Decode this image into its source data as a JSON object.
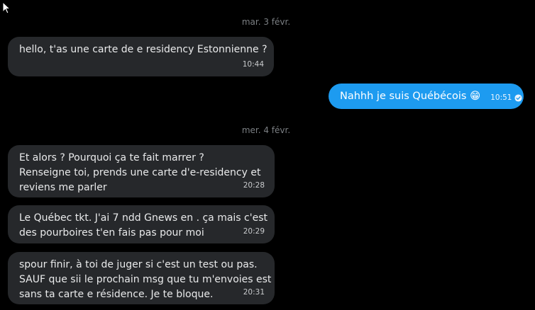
{
  "conversation": {
    "dates": [
      "mar. 3 févr.",
      "mer. 4 févr."
    ],
    "messages": [
      {
        "direction": "incoming",
        "lines": [
          "hello, t'as une carte de e residency Estonnienne ?"
        ],
        "time": "10:44"
      },
      {
        "direction": "outgoing",
        "text": "Nahhh je suis Québécois 😁",
        "time": "10:51",
        "status_icon": "read-check-icon"
      },
      {
        "direction": "incoming",
        "lines": [
          "Et alors ? Pourquoi ça te fait marrer ?",
          "Renseigne toi, prends une carte d'e-residency et",
          "reviens me parler"
        ],
        "time": "20:28"
      },
      {
        "direction": "incoming",
        "lines": [
          "Le Québec tkt. J'ai 7 ndd Gnews en . ça mais c'est",
          "des pourboires t'en fais pas pour moi"
        ],
        "time": "20:29"
      },
      {
        "direction": "incoming",
        "lines": [
          "spour finir, à toi de juger si c'est un test ou pas.",
          "SAUF que sii le prochain msg que tu m'envoies est",
          "sans ta carte e résidence. Je te bloque."
        ],
        "time": "20:31"
      }
    ]
  },
  "colors": {
    "background": "#000000",
    "incoming_bubble": "#26282b",
    "outgoing_bubble": "#1d9bf0",
    "date_text": "#7b7f83"
  }
}
